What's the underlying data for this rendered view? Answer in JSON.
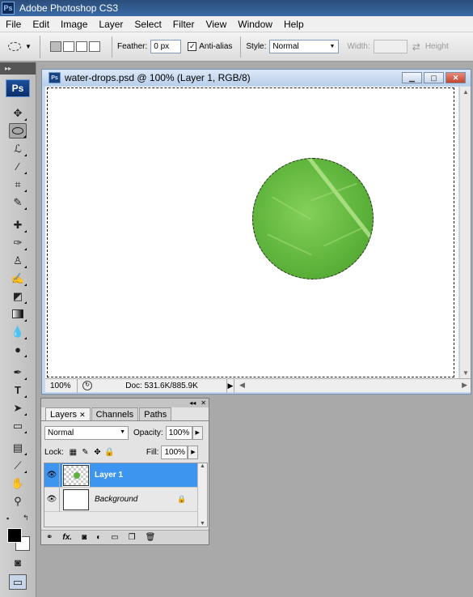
{
  "app": {
    "title": "Adobe Photoshop CS3",
    "logo": "Ps",
    "accent": "#3d95ef"
  },
  "menu": [
    "File",
    "Edit",
    "Image",
    "Layer",
    "Select",
    "Filter",
    "View",
    "Window",
    "Help"
  ],
  "options": {
    "feather_label": "Feather:",
    "feather_value": "0 px",
    "antialias_label": "Anti-alias",
    "antialias_checked": true,
    "style_label": "Style:",
    "style_value": "Normal",
    "width_label": "Width:",
    "height_label": "Height"
  },
  "toolbox": {
    "logo": "Ps",
    "tools": [
      "move-icon",
      "ellipse-marquee-icon",
      "lasso-icon",
      "magic-wand-icon",
      "crop-icon",
      "slice-icon",
      "healing-brush-icon",
      "brush-icon",
      "clone-stamp-icon",
      "history-brush-icon",
      "eraser-icon",
      "gradient-icon",
      "blur-icon",
      "dodge-icon",
      "pen-icon",
      "type-icon",
      "path-selection-icon",
      "shape-icon",
      "notes-icon",
      "eyedropper-icon",
      "hand-icon",
      "zoom-icon"
    ],
    "active_tool": "ellipse-marquee-icon"
  },
  "document": {
    "title": "water-drops.psd @ 100% (Layer 1, RGB/8)",
    "zoom": "100%",
    "doc_info": "Doc: 531.6K/885.9K"
  },
  "layers_panel": {
    "tabs": [
      "Layers",
      "Channels",
      "Paths"
    ],
    "blend_mode": "Normal",
    "opacity_label": "Opacity:",
    "opacity_value": "100%",
    "lock_label": "Lock:",
    "fill_label": "Fill:",
    "fill_value": "100%",
    "layers": [
      {
        "name": "Layer 1",
        "selected": true
      },
      {
        "name": "Background",
        "selected": false,
        "locked": true
      }
    ]
  }
}
